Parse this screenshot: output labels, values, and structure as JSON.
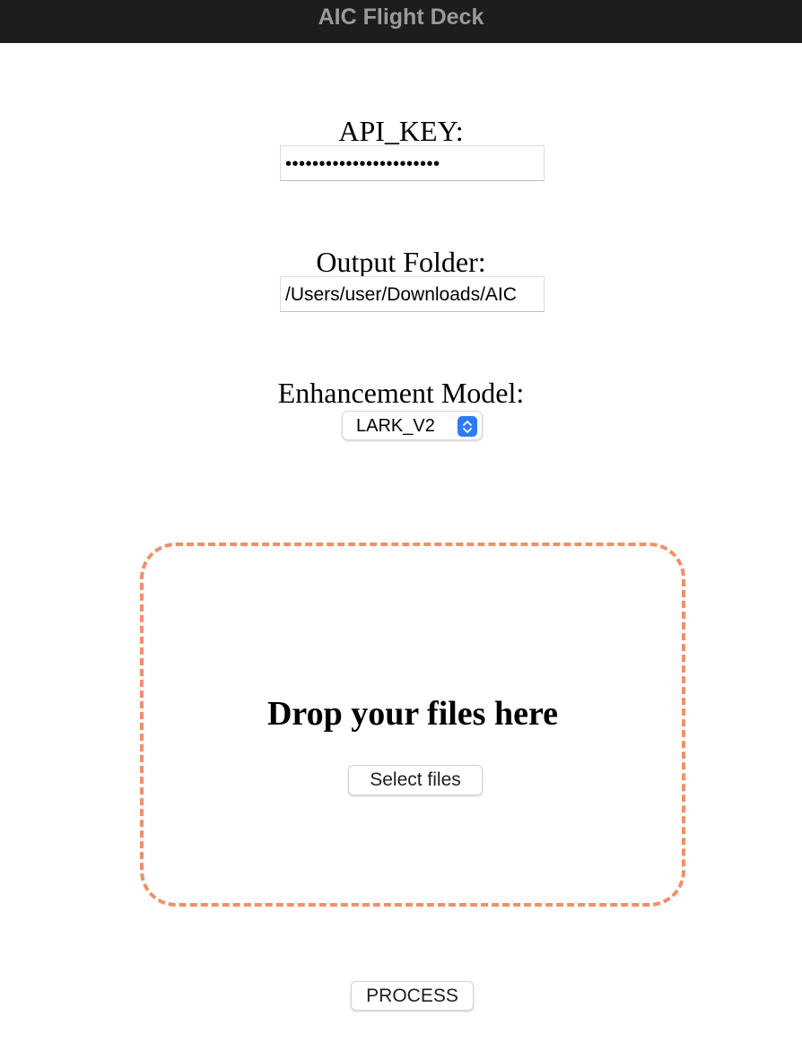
{
  "window": {
    "title": "AIC Flight Deck"
  },
  "form": {
    "api_key": {
      "label": "API_KEY:",
      "masked_value": "•••••••••••••••••••••••"
    },
    "output_folder": {
      "label": "Output Folder:",
      "value": "/Users/user/Downloads/AIC"
    },
    "enhancement_model": {
      "label": "Enhancement Model:",
      "selected": "LARK_V2"
    }
  },
  "dropzone": {
    "title": "Drop your files here",
    "select_button_label": "Select files"
  },
  "actions": {
    "process_label": "PROCESS"
  },
  "colors": {
    "titlebar_bg": "#1d1d1d",
    "titlebar_text": "#9a9a9a",
    "dropzone_border": "#f0906a",
    "select_accent": "#2c7cf6"
  },
  "icons": {
    "select_arrow": "chevron-up-down-icon"
  }
}
